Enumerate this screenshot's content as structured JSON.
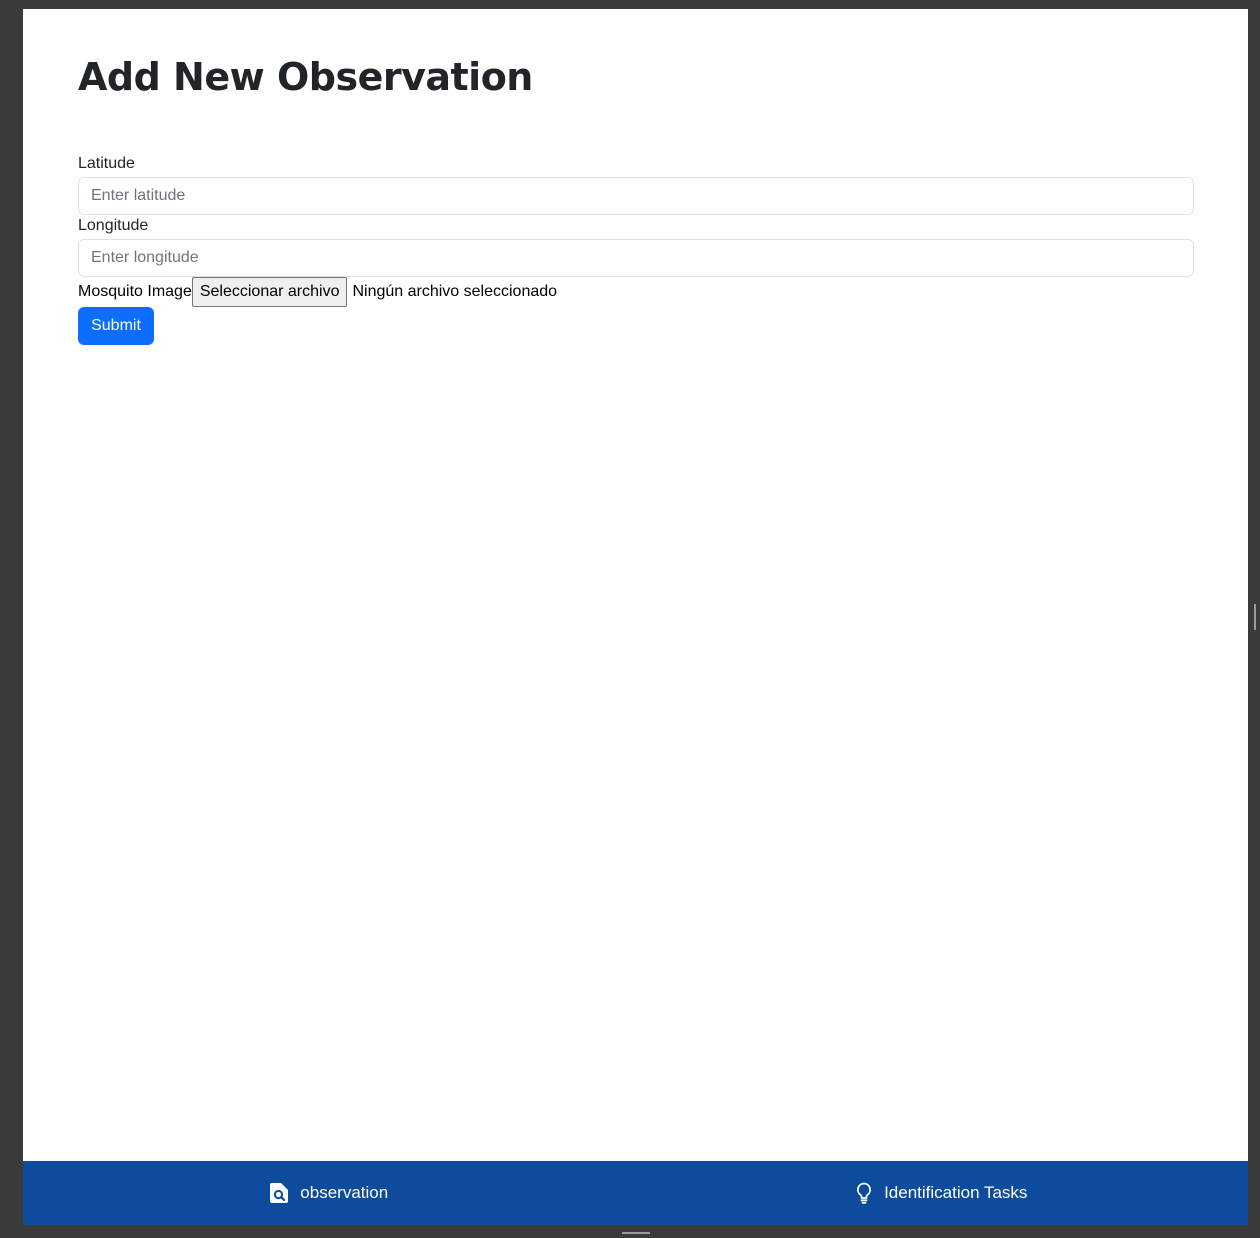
{
  "form": {
    "title": "Add New Observation",
    "latitude": {
      "label": "Latitude",
      "placeholder": "Enter latitude",
      "value": ""
    },
    "longitude": {
      "label": "Longitude",
      "placeholder": "Enter longitude",
      "value": ""
    },
    "image": {
      "label": "Mosquito Image",
      "button_label": "Seleccionar archivo",
      "status": "Ningún archivo seleccionado"
    },
    "submit_label": "Submit"
  },
  "nav": {
    "items": [
      {
        "label": "observation",
        "icon": "file-search-icon"
      },
      {
        "label": "Identification Tasks",
        "icon": "lightbulb-icon"
      }
    ]
  },
  "colors": {
    "primary": "#0d6efd",
    "nav_background": "#0d4b9c"
  }
}
